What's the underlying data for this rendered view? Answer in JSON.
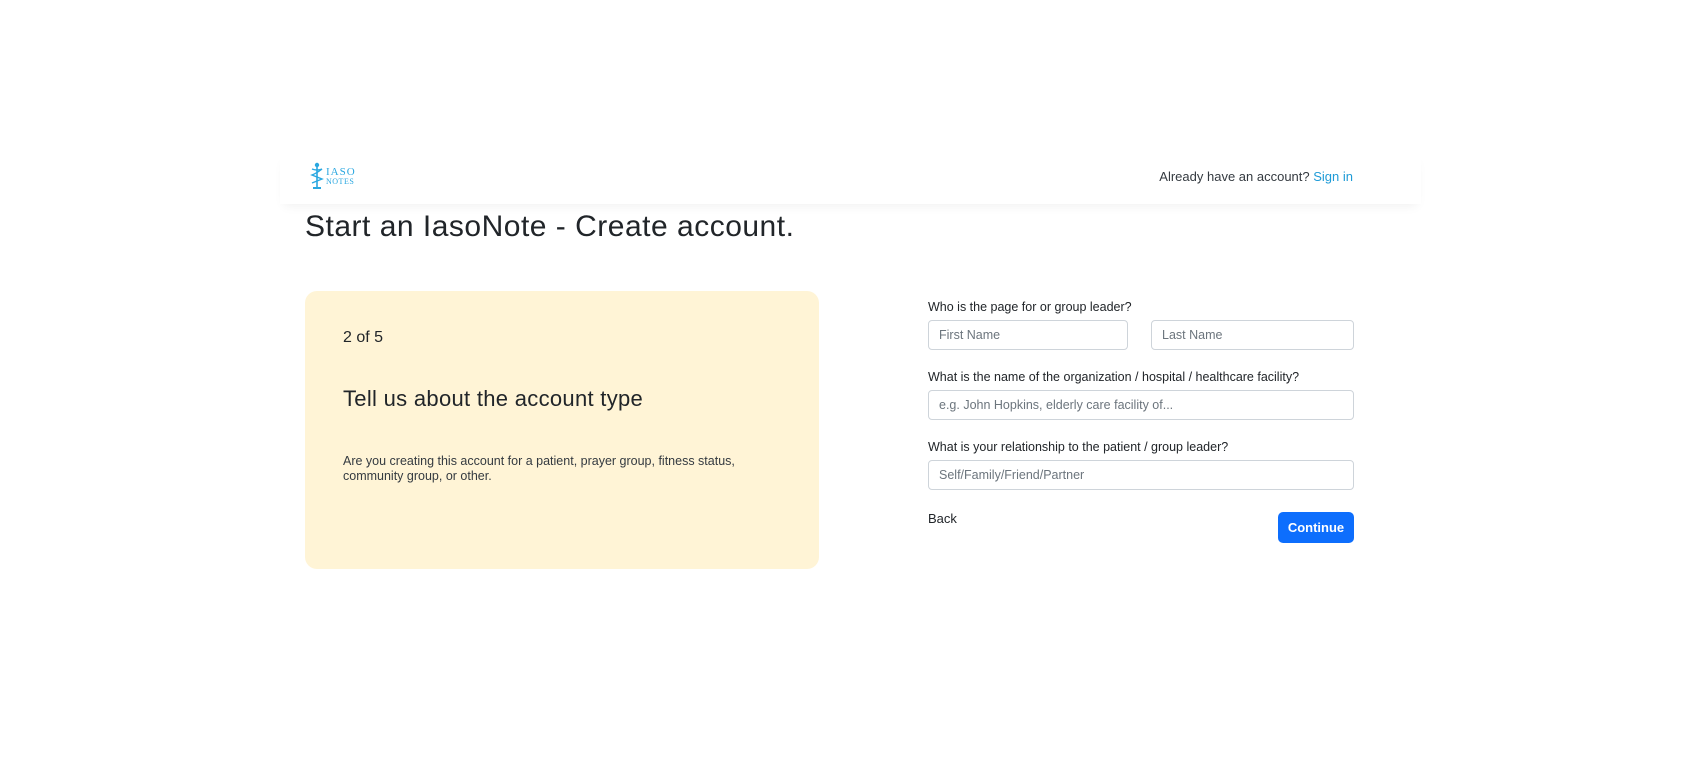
{
  "header": {
    "logo": {
      "line1": "IASO",
      "line2": "NOTES",
      "icon": "caduceus-icon",
      "color": "#2aa7e0"
    },
    "signin_prompt": "Already have an account?",
    "signin_link": "Sign in"
  },
  "page_title": "Start an IasoNote - Create account.",
  "info_card": {
    "step": "2 of 5",
    "heading": "Tell us about the account type",
    "description": "Are you creating this account for a patient, prayer group, fitness status, community group, or other.",
    "background": "#fff4d6"
  },
  "form": {
    "q1_label": "Who is the page for or group leader?",
    "first_name_placeholder": "First Name",
    "last_name_placeholder": "Last Name",
    "q2_label": "What is the name of the organization / hospital / healthcare facility?",
    "org_placeholder": "e.g. John Hopkins, elderly care facility of...",
    "q3_label": "What is your relationship to the patient / group leader?",
    "relationship_placeholder": "Self/Family/Friend/Partner",
    "back_label": "Back",
    "continue_label": "Continue",
    "accent_color": "#0d6efd"
  }
}
